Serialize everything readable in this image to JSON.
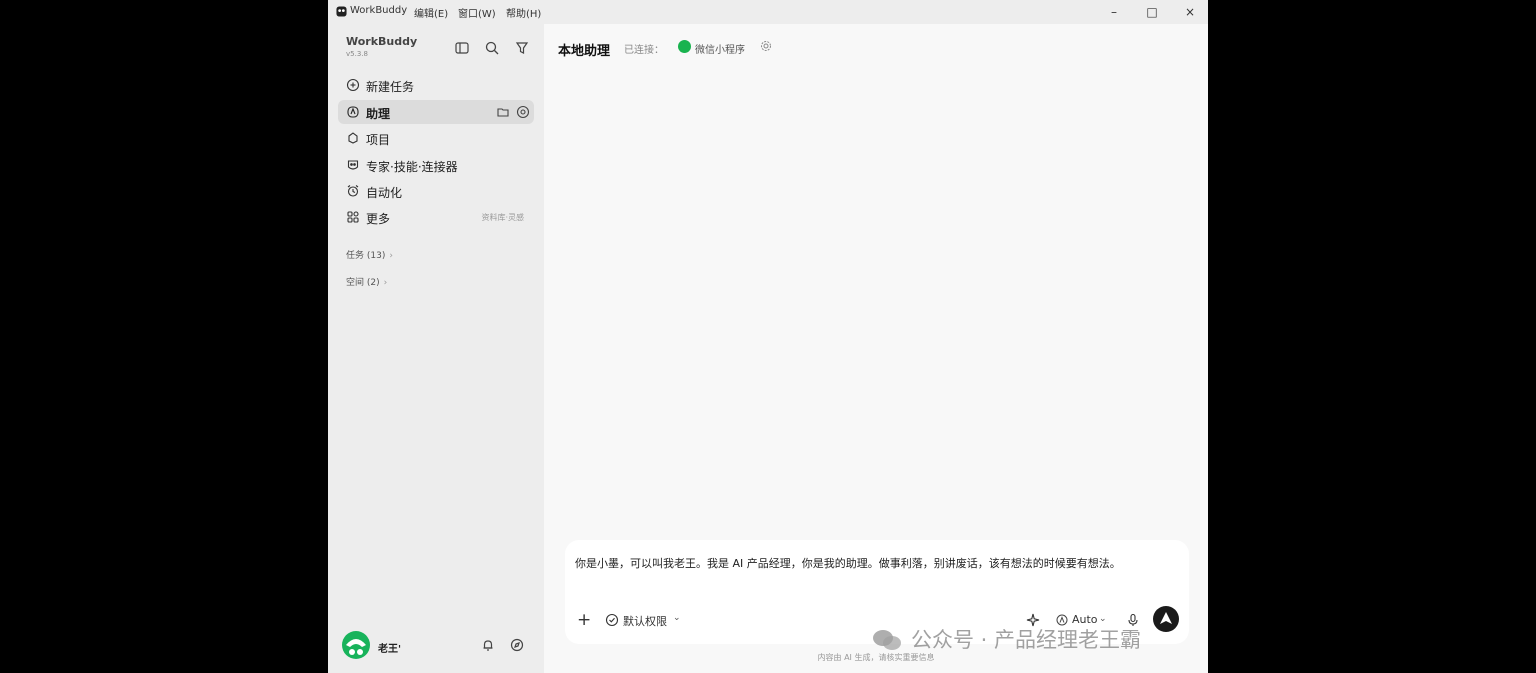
{
  "titlebar": {
    "app_name": "WorkBuddy",
    "menus": [
      "编辑(E)",
      "窗口(W)",
      "帮助(H)"
    ],
    "minimize": "–",
    "maximize": "□",
    "close": "×"
  },
  "sidebar": {
    "brand": "WorkBuddy",
    "version": "v5.3.8",
    "nav": [
      {
        "label": "新建任务",
        "icon": "plus-circle-icon"
      },
      {
        "label": "助理",
        "icon": "assistant-icon",
        "active": true
      },
      {
        "label": "项目",
        "icon": "project-icon"
      },
      {
        "label": "专家·技能·连接器",
        "icon": "expert-icon"
      },
      {
        "label": "自动化",
        "icon": "alarm-icon"
      },
      {
        "label": "更多",
        "icon": "grid-icon",
        "extra": "资料库·灵感"
      }
    ],
    "sections": [
      {
        "label": "任务 (13)"
      },
      {
        "label": "空间 (2)"
      }
    ],
    "user": {
      "name": "老王'"
    }
  },
  "main": {
    "title": "本地助理",
    "connected_label": "已连接：",
    "connected_service": "微信小程序",
    "composer": {
      "text": "你是小墨，可以叫我老王。我是 AI 产品经理，你是我的助理。做事利落，别讲废话，该有想法的时候要有想法。",
      "permission": "默认权限",
      "model": "Auto"
    },
    "disclaimer": "内容由 AI 生成，请核实重要信息"
  },
  "watermark": "公众号 · 产品经理老王霸",
  "colors": {
    "accent_green": "#19b34f",
    "send_button": "#1a1a1a"
  }
}
